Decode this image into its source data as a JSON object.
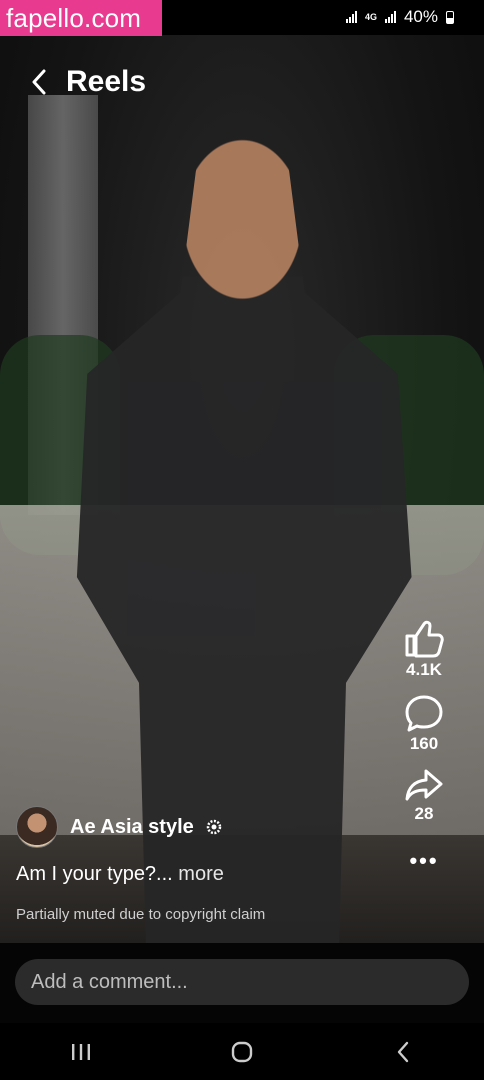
{
  "watermark": "fapello.com",
  "status_bar": {
    "network": "4G",
    "battery": "40%"
  },
  "header": {
    "title": "Reels"
  },
  "actions": {
    "likes": "4.1K",
    "comments": "160",
    "shares": "28"
  },
  "author": {
    "name": "Ae Asia style"
  },
  "caption": {
    "text": "Am I your type?...",
    "more": "more"
  },
  "notice": "Partially muted due to copyright claim",
  "comment": {
    "placeholder": "Add a comment..."
  },
  "icons": {
    "back": "chevron-left-icon",
    "like": "thumbs-up-icon",
    "comment": "speech-bubble-icon",
    "share": "share-arrow-icon",
    "more": "more-horizontal-icon",
    "verified": "verified-badge-icon"
  }
}
